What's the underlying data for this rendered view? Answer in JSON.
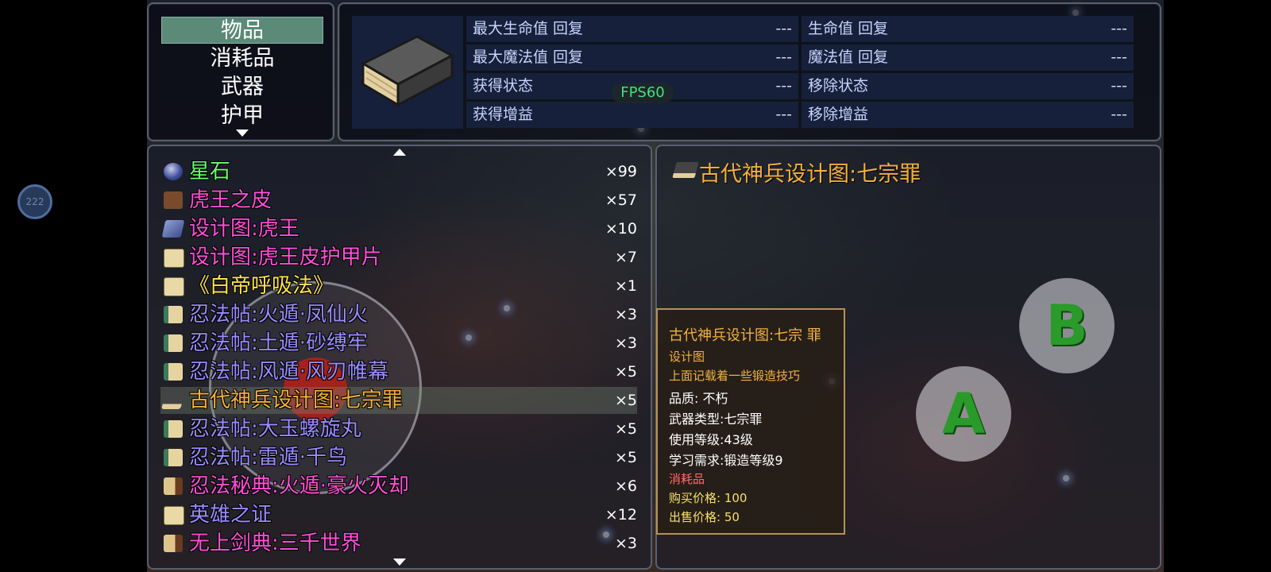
{
  "categories": [
    {
      "label": "物品",
      "selected": true
    },
    {
      "label": "消耗品",
      "selected": false
    },
    {
      "label": "武器",
      "selected": false
    },
    {
      "label": "护甲",
      "selected": false
    }
  ],
  "stats": [
    {
      "label": "最大生命值 回复",
      "value": "---"
    },
    {
      "label": "生命值 回复",
      "value": "---"
    },
    {
      "label": "最大魔法值 回复",
      "value": "---"
    },
    {
      "label": "魔法值 回复",
      "value": "---"
    },
    {
      "label": "获得状态",
      "value": "---"
    },
    {
      "label": "移除状态",
      "value": "---"
    },
    {
      "label": "获得增益",
      "value": "---"
    },
    {
      "label": "移除增益",
      "value": "---"
    }
  ],
  "fps": "FPS60",
  "badge": "222",
  "items": [
    {
      "name": "星石",
      "qty": "×99",
      "color": "#6bff6b",
      "icon": "orb-icon"
    },
    {
      "name": "虎王之皮",
      "qty": "×57",
      "color": "#ff4fd8",
      "icon": "pelt-icon"
    },
    {
      "name": "设计图:虎王",
      "qty": "×10",
      "color": "#ff4fd8",
      "icon": "blueprint-icon"
    },
    {
      "name": "设计图:虎王皮护甲片",
      "qty": "×7",
      "color": "#ff4fd8",
      "icon": "paper-icon"
    },
    {
      "name": "《白帝呼吸法》",
      "qty": "×1",
      "color": "#ffe34a",
      "icon": "paper-icon"
    },
    {
      "name": "忍法帖:火遁·凤仙火",
      "qty": "×3",
      "color": "#9a8cff",
      "icon": "scroll-icon"
    },
    {
      "name": "忍法帖:土遁·砂缚牢",
      "qty": "×3",
      "color": "#9a8cff",
      "icon": "scroll-icon"
    },
    {
      "name": "忍法帖:风遁·风刃帷幕",
      "qty": "×5",
      "color": "#9a8cff",
      "icon": "scroll-icon"
    },
    {
      "name": "古代神兵设计图:七宗罪",
      "qty": "×5",
      "color": "#f5b038",
      "icon": "book-icon",
      "selected": true
    },
    {
      "name": "忍法帖:大玉螺旋丸",
      "qty": "×5",
      "color": "#9a8cff",
      "icon": "scroll-icon"
    },
    {
      "name": "忍法帖:雷遁·千鸟",
      "qty": "×5",
      "color": "#9a8cff",
      "icon": "scroll-icon"
    },
    {
      "name": "忍法秘典:火遁·豪火灭却",
      "qty": "×6",
      "color": "#ff4fd8",
      "icon": "tome-icon"
    },
    {
      "name": "英雄之证",
      "qty": "×12",
      "color": "#9a8cff",
      "icon": "paper-icon"
    },
    {
      "name": "无上剑典:三千世界",
      "qty": "×3",
      "color": "#ff4fd8",
      "icon": "tome-icon"
    }
  ],
  "detail": {
    "title": "古代神兵设计图:七宗罪"
  },
  "tooltip": {
    "title": "古代神兵设计图:七宗 罪",
    "type": "设计图",
    "desc": "上面记载着一些锻造技巧",
    "quality": "品质: 不朽",
    "weapon_type": "武器类型:七宗罪",
    "use_level": "使用等级:43级",
    "requirement": "学习需求:锻造等级9",
    "consumable": "消耗品",
    "buy": "购买价格: 100",
    "sell": "出售价格: 50"
  },
  "buttons": {
    "a": "A",
    "b": "B"
  }
}
